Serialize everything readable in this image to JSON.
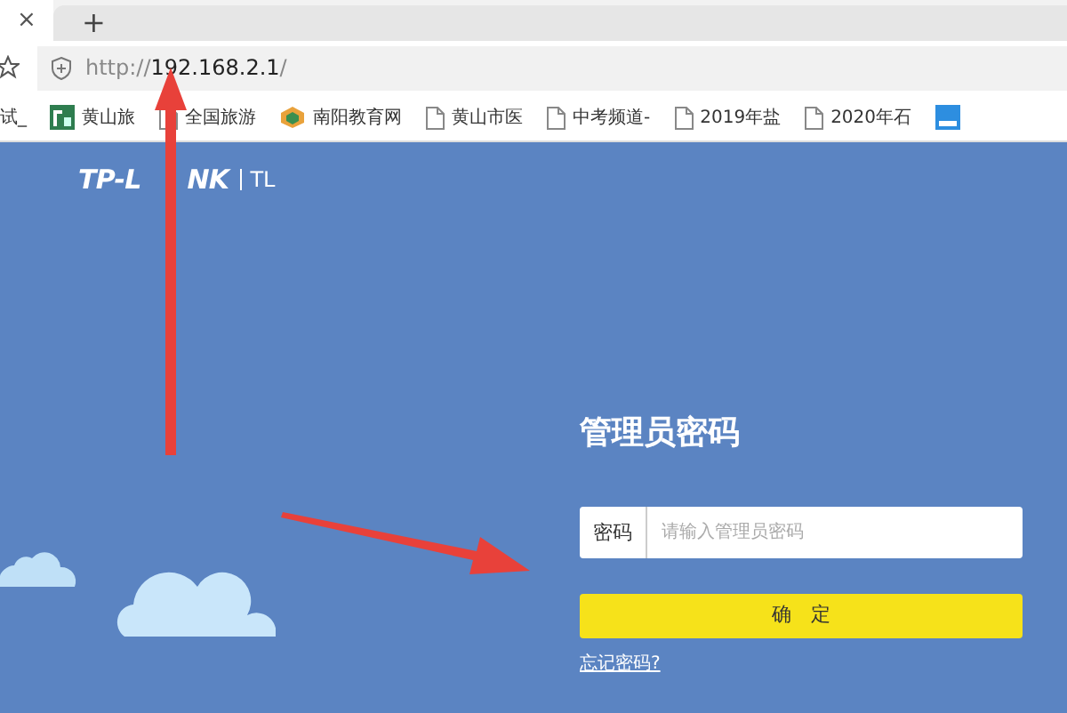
{
  "browser": {
    "tab_close": "×",
    "new_tab": "+",
    "url_scheme": "http://",
    "url_host": "192.168.2.1",
    "url_path": "/"
  },
  "bookmarks": [
    {
      "label": "试_",
      "kind": "cut"
    },
    {
      "label": "黄山旅",
      "kind": "site"
    },
    {
      "label": "全国旅游",
      "kind": "page"
    },
    {
      "label": "南阳教育网",
      "kind": "hex"
    },
    {
      "label": "黄山市医",
      "kind": "page"
    },
    {
      "label": "中考频道-",
      "kind": "page"
    },
    {
      "label": "2019年盐",
      "kind": "page"
    },
    {
      "label": "2020年石",
      "kind": "page"
    },
    {
      "kind": "edu"
    }
  ],
  "header": {
    "logo": [
      "TP-L",
      "NK"
    ],
    "model": "TL"
  },
  "login": {
    "title": "管理员密码",
    "field_label": "密码",
    "placeholder": "请输入管理员密码",
    "submit": "确　定",
    "forgot": "忘记密码?"
  }
}
